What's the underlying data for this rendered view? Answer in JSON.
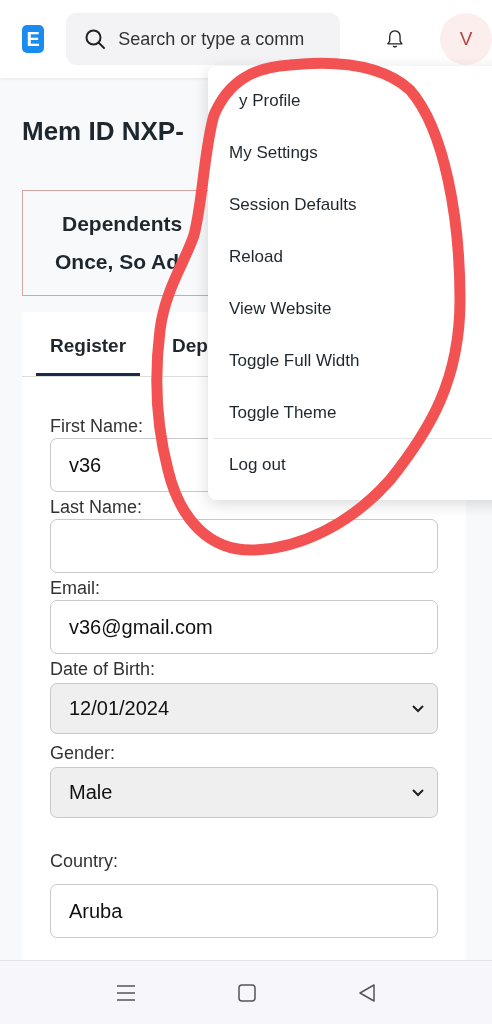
{
  "header": {
    "logo": {
      "letter": "E"
    },
    "search": {
      "placeholder": "Search or type a comm"
    },
    "avatar": {
      "initial": "V"
    }
  },
  "title": "Mem ID NXP-",
  "banner": {
    "lines": [
      "Dependents",
      "Once, So Ad"
    ]
  },
  "tabs": [
    {
      "label": "Register",
      "selected": true
    },
    {
      "label": "Dep",
      "selected": false
    }
  ],
  "form": {
    "fields": [
      {
        "label": "First Name:",
        "kind": "input",
        "value": "v36"
      },
      {
        "label": "Last Name:",
        "kind": "input"
      },
      {
        "label": "Email:",
        "kind": "input",
        "value": "v36@gmail.com"
      },
      {
        "label": "Date of Birth:",
        "kind": "select",
        "value": "12/01/2024"
      },
      {
        "label": "Gender:",
        "kind": "select",
        "value": "Male"
      },
      {
        "label": "Country:",
        "kind": "input",
        "value": "Aruba"
      }
    ]
  },
  "user_menu": {
    "items": [
      {
        "label": "y Profile",
        "divider_before": false
      },
      {
        "label": "My Settings",
        "divider_before": false
      },
      {
        "label": "Session Defaults",
        "divider_before": false
      },
      {
        "label": "Reload",
        "divider_before": false
      },
      {
        "label": "View Website",
        "divider_before": false
      },
      {
        "label": "Toggle Full Width",
        "divider_before": false
      },
      {
        "label": "Toggle Theme",
        "divider_before": false
      },
      {
        "label": "Log out",
        "divider_before": true
      }
    ]
  },
  "annotation": {
    "kind": "circle"
  }
}
